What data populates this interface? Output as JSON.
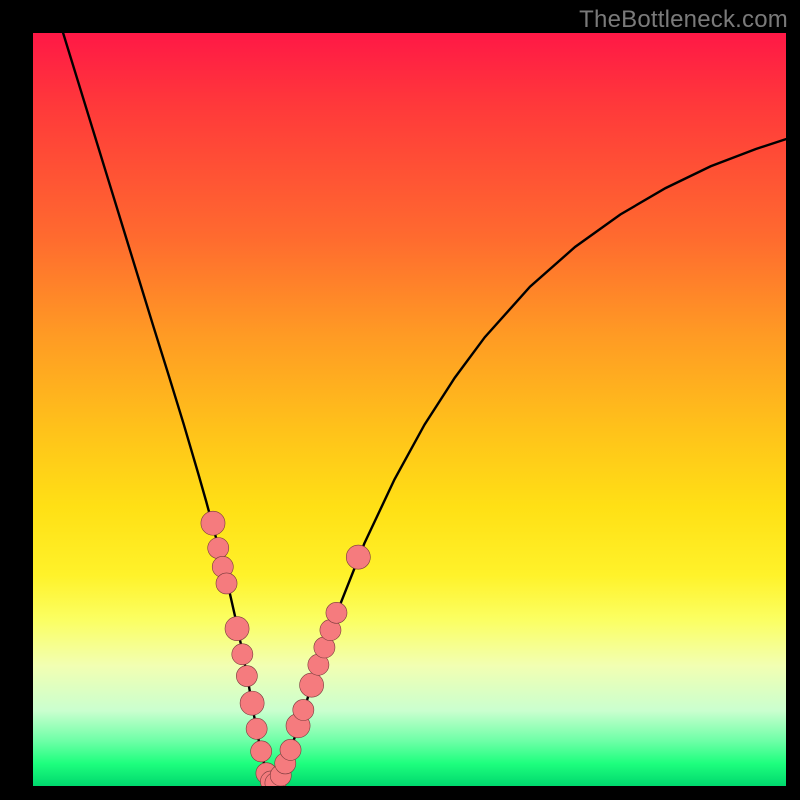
{
  "watermark": "TheBottleneck.com",
  "colors": {
    "frame": "#000000",
    "curve": "#000000",
    "marker_fill": "#f57b7e",
    "marker_stroke": "#7a3a3c"
  },
  "chart_data": {
    "type": "line",
    "title": "",
    "xlabel": "",
    "ylabel": "",
    "xlim": [
      0,
      100
    ],
    "ylim": [
      0,
      100
    ],
    "grid": false,
    "legend": false,
    "series": [
      {
        "name": "bottleneck-curve",
        "x": [
          4,
          6,
          8,
          10,
          12,
          14,
          16,
          18,
          20,
          22,
          23,
          24,
          25,
          26,
          27,
          27.8,
          28.6,
          29.4,
          30.2,
          31,
          32,
          33,
          34,
          36,
          38,
          40,
          44,
          48,
          52,
          56,
          60,
          66,
          72,
          78,
          84,
          90,
          96,
          100
        ],
        "y": [
          100,
          93.5,
          87,
          80.5,
          74,
          67.5,
          61,
          54.6,
          48.1,
          41.3,
          37.8,
          34.1,
          30.3,
          26.2,
          21.8,
          17.9,
          13.7,
          9.1,
          4.9,
          1.8,
          0.3,
          1.6,
          4.2,
          10.2,
          16.4,
          22.1,
          32.2,
          40.7,
          48.0,
          54.2,
          59.6,
          66.3,
          71.6,
          75.9,
          79.4,
          82.3,
          84.6,
          85.9
        ]
      }
    ],
    "markers": [
      {
        "x": 23.9,
        "y": 34.9,
        "r": 1.6
      },
      {
        "x": 24.6,
        "y": 31.6,
        "r": 1.4
      },
      {
        "x": 25.2,
        "y": 29.1,
        "r": 1.4
      },
      {
        "x": 25.7,
        "y": 26.9,
        "r": 1.4
      },
      {
        "x": 27.1,
        "y": 20.9,
        "r": 1.6
      },
      {
        "x": 27.8,
        "y": 17.5,
        "r": 1.4
      },
      {
        "x": 28.4,
        "y": 14.6,
        "r": 1.4
      },
      {
        "x": 29.1,
        "y": 11.0,
        "r": 1.6
      },
      {
        "x": 29.7,
        "y": 7.6,
        "r": 1.4
      },
      {
        "x": 30.3,
        "y": 4.6,
        "r": 1.4
      },
      {
        "x": 31.0,
        "y": 1.7,
        "r": 1.4
      },
      {
        "x": 31.6,
        "y": 0.6,
        "r": 1.4
      },
      {
        "x": 32.2,
        "y": 0.4,
        "r": 1.4
      },
      {
        "x": 32.9,
        "y": 1.4,
        "r": 1.4
      },
      {
        "x": 33.5,
        "y": 3.0,
        "r": 1.4
      },
      {
        "x": 34.2,
        "y": 4.8,
        "r": 1.4
      },
      {
        "x": 35.2,
        "y": 8.0,
        "r": 1.6
      },
      {
        "x": 35.9,
        "y": 10.1,
        "r": 1.4
      },
      {
        "x": 37.0,
        "y": 13.4,
        "r": 1.6
      },
      {
        "x": 37.9,
        "y": 16.1,
        "r": 1.4
      },
      {
        "x": 38.7,
        "y": 18.4,
        "r": 1.4
      },
      {
        "x": 39.5,
        "y": 20.7,
        "r": 1.4
      },
      {
        "x": 40.3,
        "y": 23.0,
        "r": 1.4
      },
      {
        "x": 43.2,
        "y": 30.4,
        "r": 1.6
      }
    ]
  }
}
